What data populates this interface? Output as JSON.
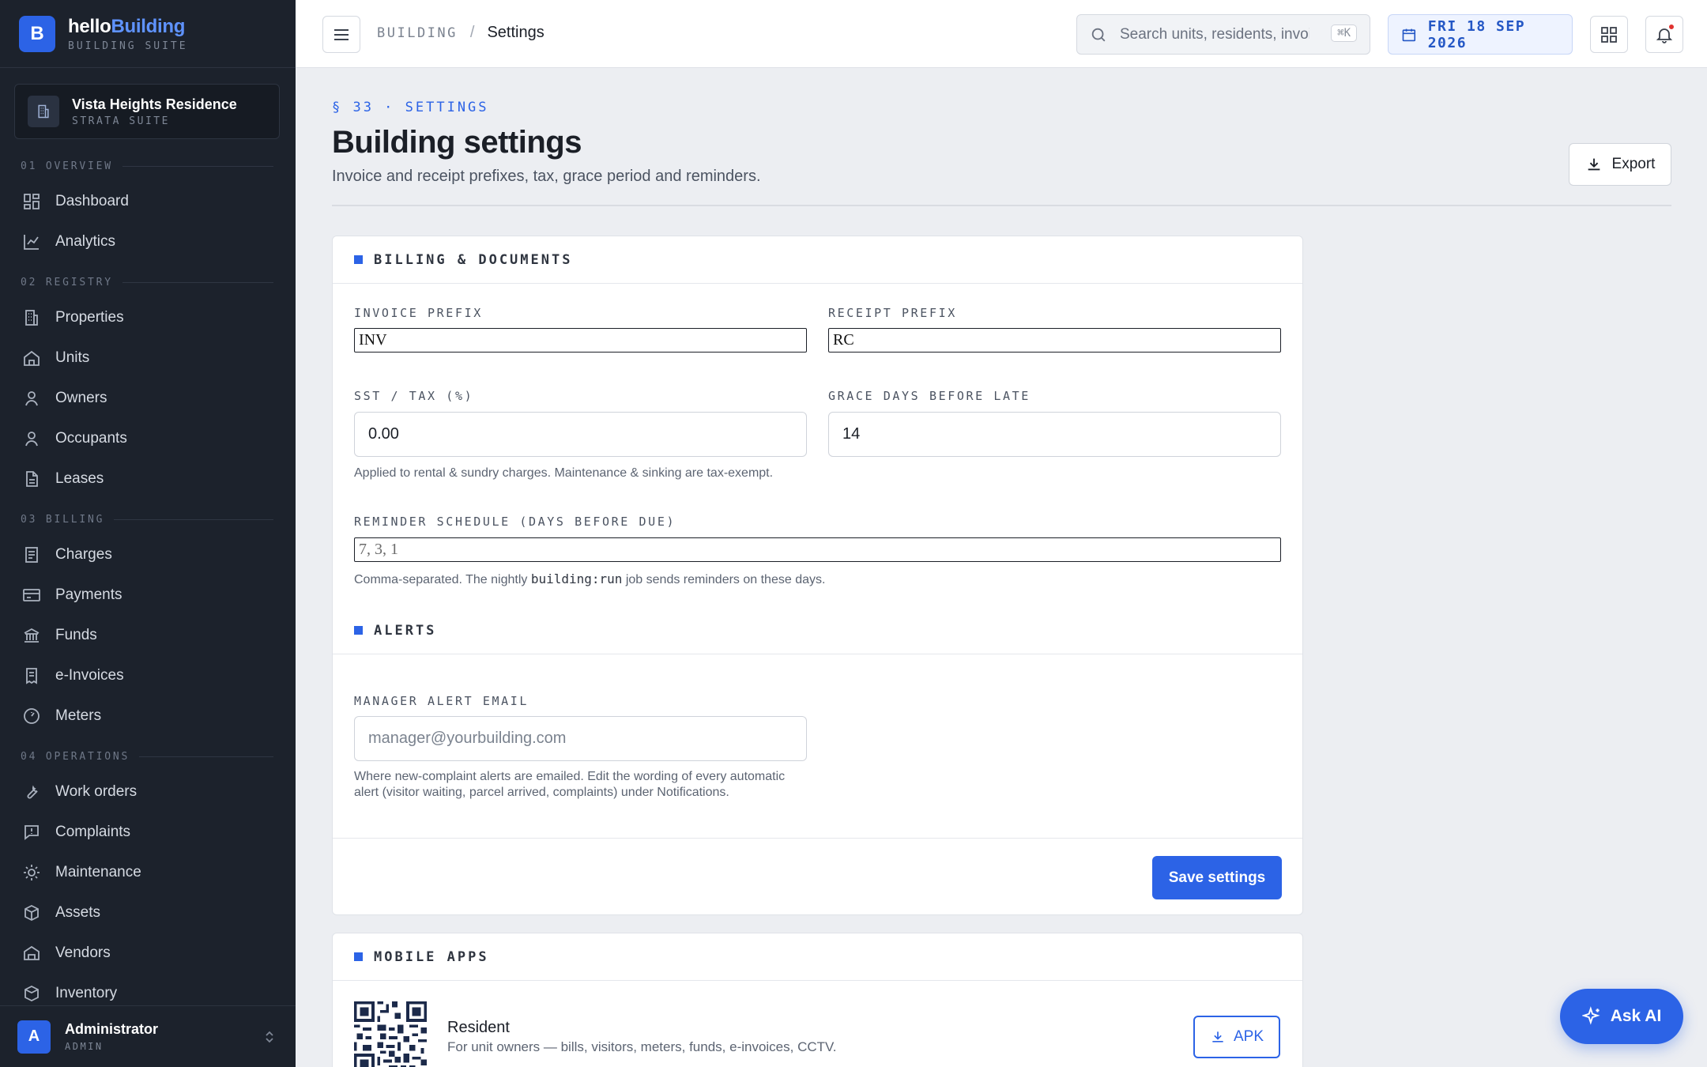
{
  "brand": {
    "prefix": "hello",
    "accent": "Building",
    "subtitle": "BUILDING SUITE",
    "logo_letter": "B"
  },
  "property": {
    "name": "Vista Heights Residence",
    "subtitle": "STRATA SUITE"
  },
  "nav": {
    "sections": [
      {
        "title": "01 OVERVIEW",
        "items": [
          {
            "label": "Dashboard",
            "icon": "dashboard-icon"
          },
          {
            "label": "Analytics",
            "icon": "analytics-icon"
          }
        ]
      },
      {
        "title": "02 REGISTRY",
        "items": [
          {
            "label": "Properties",
            "icon": "building-icon"
          },
          {
            "label": "Units",
            "icon": "home-icon"
          },
          {
            "label": "Owners",
            "icon": "person-icon"
          },
          {
            "label": "Occupants",
            "icon": "person-icon"
          },
          {
            "label": "Leases",
            "icon": "document-icon"
          }
        ]
      },
      {
        "title": "03 BILLING",
        "items": [
          {
            "label": "Charges",
            "icon": "receipt-icon"
          },
          {
            "label": "Payments",
            "icon": "credit-card-icon"
          },
          {
            "label": "Funds",
            "icon": "bank-icon"
          },
          {
            "label": "e-Invoices",
            "icon": "invoice-icon"
          },
          {
            "label": "Meters",
            "icon": "gauge-icon"
          }
        ]
      },
      {
        "title": "04 OPERATIONS",
        "items": [
          {
            "label": "Work orders",
            "icon": "wrench-icon"
          },
          {
            "label": "Complaints",
            "icon": "alert-message-icon"
          },
          {
            "label": "Maintenance",
            "icon": "sun-gear-icon"
          },
          {
            "label": "Assets",
            "icon": "cube-icon"
          },
          {
            "label": "Vendors",
            "icon": "store-icon"
          },
          {
            "label": "Inventory",
            "icon": "box-icon"
          }
        ]
      }
    ]
  },
  "user": {
    "name": "Administrator",
    "role": "ADMIN",
    "avatar_letter": "A"
  },
  "topbar": {
    "breadcrumb_root": "BUILDING",
    "breadcrumb_sep": "/",
    "breadcrumb_current": "Settings",
    "search_placeholder": "Search units, residents, invoi",
    "search_shortcut": "⌘K",
    "date": "FRI 18 SEP 2026"
  },
  "page": {
    "eyebrow": "§ 33 · SETTINGS",
    "title": "Building settings",
    "subtitle": "Invoice and receipt prefixes, tax, grace period and reminders.",
    "export_label": "Export"
  },
  "billing": {
    "title": "BILLING & DOCUMENTS",
    "invoice_prefix": {
      "label": "INVOICE PREFIX",
      "value": "INV"
    },
    "receipt_prefix": {
      "label": "RECEIPT PREFIX",
      "value": "RC"
    },
    "tax": {
      "label": "SST / TAX (%)",
      "value": "0.00",
      "help": "Applied to rental & sundry charges. Maintenance & sinking are tax-exempt."
    },
    "grace": {
      "label": "GRACE DAYS BEFORE LATE",
      "value": "14"
    },
    "reminder": {
      "label": "REMINDER SCHEDULE (DAYS BEFORE DUE)",
      "placeholder": "7, 3, 1",
      "help_before": "Comma-separated. The nightly ",
      "help_code": "building:run",
      "help_after": " job sends reminders on these days."
    }
  },
  "alerts": {
    "title": "ALERTS",
    "email": {
      "label": "MANAGER ALERT EMAIL",
      "placeholder": "manager@yourbuilding.com",
      "help_line1": "Where new-complaint alerts are emailed. Edit the wording of every automatic",
      "help_line2": "alert (visitor waiting, parcel arrived, complaints) under Notifications."
    },
    "save_label": "Save settings"
  },
  "mobile": {
    "title": "MOBILE APPS",
    "app_name": "Resident",
    "app_desc": "For unit owners — bills, visitors, meters, funds, e-invoices, CCTV.",
    "apk_label": "APK"
  },
  "ask_ai_label": "Ask AI",
  "colors": {
    "accent": "#2c63e6",
    "sidebar": "#1c222c",
    "background": "#eceef2",
    "notification_dot": "#e0322f"
  }
}
